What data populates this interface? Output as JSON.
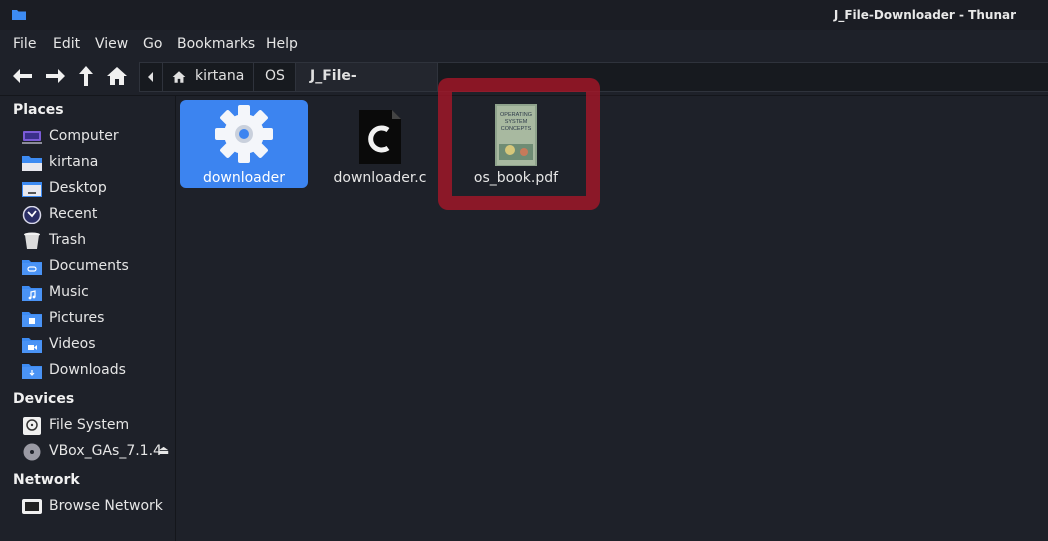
{
  "window": {
    "title": "J_File-Downloader - Thunar"
  },
  "menu": {
    "items": [
      "File",
      "Edit",
      "View",
      "Go",
      "Bookmarks",
      "Help"
    ]
  },
  "toolbar": {
    "buttons": [
      "back-arrow-icon",
      "forward-arrow-icon",
      "up-arrow-icon",
      "home-icon"
    ]
  },
  "pathbar": {
    "crumbs": [
      "kirtana",
      "OS",
      "J_File-Downloader"
    ]
  },
  "sidebar": {
    "places_title": "Places",
    "places": [
      "Computer",
      "kirtana",
      "Desktop",
      "Recent",
      "Trash",
      "Documents",
      "Music",
      "Pictures",
      "Videos",
      "Downloads"
    ],
    "devices_title": "Devices",
    "devices": [
      "File System",
      "VBox_GAs_7.1.4"
    ],
    "network_title": "Network",
    "network": [
      "Browse Network"
    ]
  },
  "files": [
    {
      "name": "downloader",
      "icon": "gear-icon",
      "selected": true
    },
    {
      "name": "downloader.c",
      "icon": "c-source-icon",
      "selected": false
    },
    {
      "name": "os_book.pdf",
      "icon": "pdf-book-thumbnail",
      "selected": false
    }
  ],
  "book_cover": {
    "title_lines": [
      "OPERATING",
      "SYSTEM",
      "CONCEPTS"
    ]
  },
  "colors": {
    "selection": "#3c84f0",
    "highlight": "#aa1628",
    "background": "#1e2129"
  }
}
